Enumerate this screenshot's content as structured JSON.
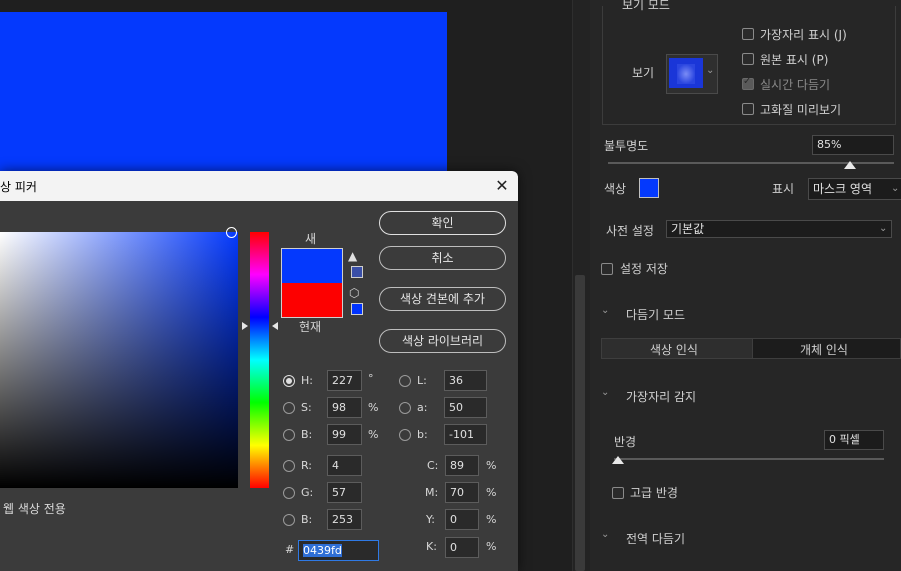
{
  "colors": {
    "new": "#0439fd",
    "current": "#fd0000",
    "canvas": "#0439fd"
  },
  "panel": {
    "view_mode_header": "보기 모드",
    "view_label": "보기",
    "options": [
      {
        "label": "가장자리 표시 (J)",
        "checked": false
      },
      {
        "label": "원본 표시 (P)",
        "checked": false
      },
      {
        "label": "실시간 다듬기",
        "checked": true
      },
      {
        "label": "고화질 미리보기",
        "checked": false
      }
    ],
    "opacity_label": "불투명도",
    "opacity_value": "85%",
    "opacity_fraction": 0.85,
    "color_label": "색상",
    "display_label": "표시",
    "display_value": "마스크 영역",
    "preset_label": "사전 설정",
    "preset_value": "기본값",
    "save_settings_label": "설정 저장",
    "refine_mode_header": "다듬기 모드",
    "refine_tabs": [
      "색상 인식",
      "개체 인식"
    ],
    "edge_detection_header": "가장자리 감지",
    "radius_label": "반경",
    "radius_value": "0 픽셀",
    "smart_radius_label": "고급 반경",
    "global_refine_header": "전역 다듬기"
  },
  "dialog": {
    "title": "상 피커",
    "new_label": "새",
    "current_label": "현재",
    "ok": "확인",
    "cancel": "취소",
    "add_to_swatches": "색상 견본에 추가",
    "color_libraries": "색상 라이브러리",
    "web_only": "웹 색상 전용",
    "hsb": [
      {
        "key": "H:",
        "value": "227",
        "unit": "°",
        "selected": true
      },
      {
        "key": "S:",
        "value": "98",
        "unit": "%",
        "selected": false
      },
      {
        "key": "B:",
        "value": "99",
        "unit": "%",
        "selected": false
      }
    ],
    "lab": [
      {
        "key": "L:",
        "value": "36"
      },
      {
        "key": "a:",
        "value": "50"
      },
      {
        "key": "b:",
        "value": "-101"
      }
    ],
    "rgb": [
      {
        "key": "R:",
        "value": "4"
      },
      {
        "key": "G:",
        "value": "57"
      },
      {
        "key": "B:",
        "value": "253"
      }
    ],
    "cmyk": [
      {
        "key": "C:",
        "value": "89",
        "unit": "%"
      },
      {
        "key": "M:",
        "value": "70",
        "unit": "%"
      },
      {
        "key": "Y:",
        "value": "0",
        "unit": "%"
      },
      {
        "key": "K:",
        "value": "0",
        "unit": "%"
      }
    ],
    "hex_label": "#",
    "hex_value": "0439fd"
  }
}
